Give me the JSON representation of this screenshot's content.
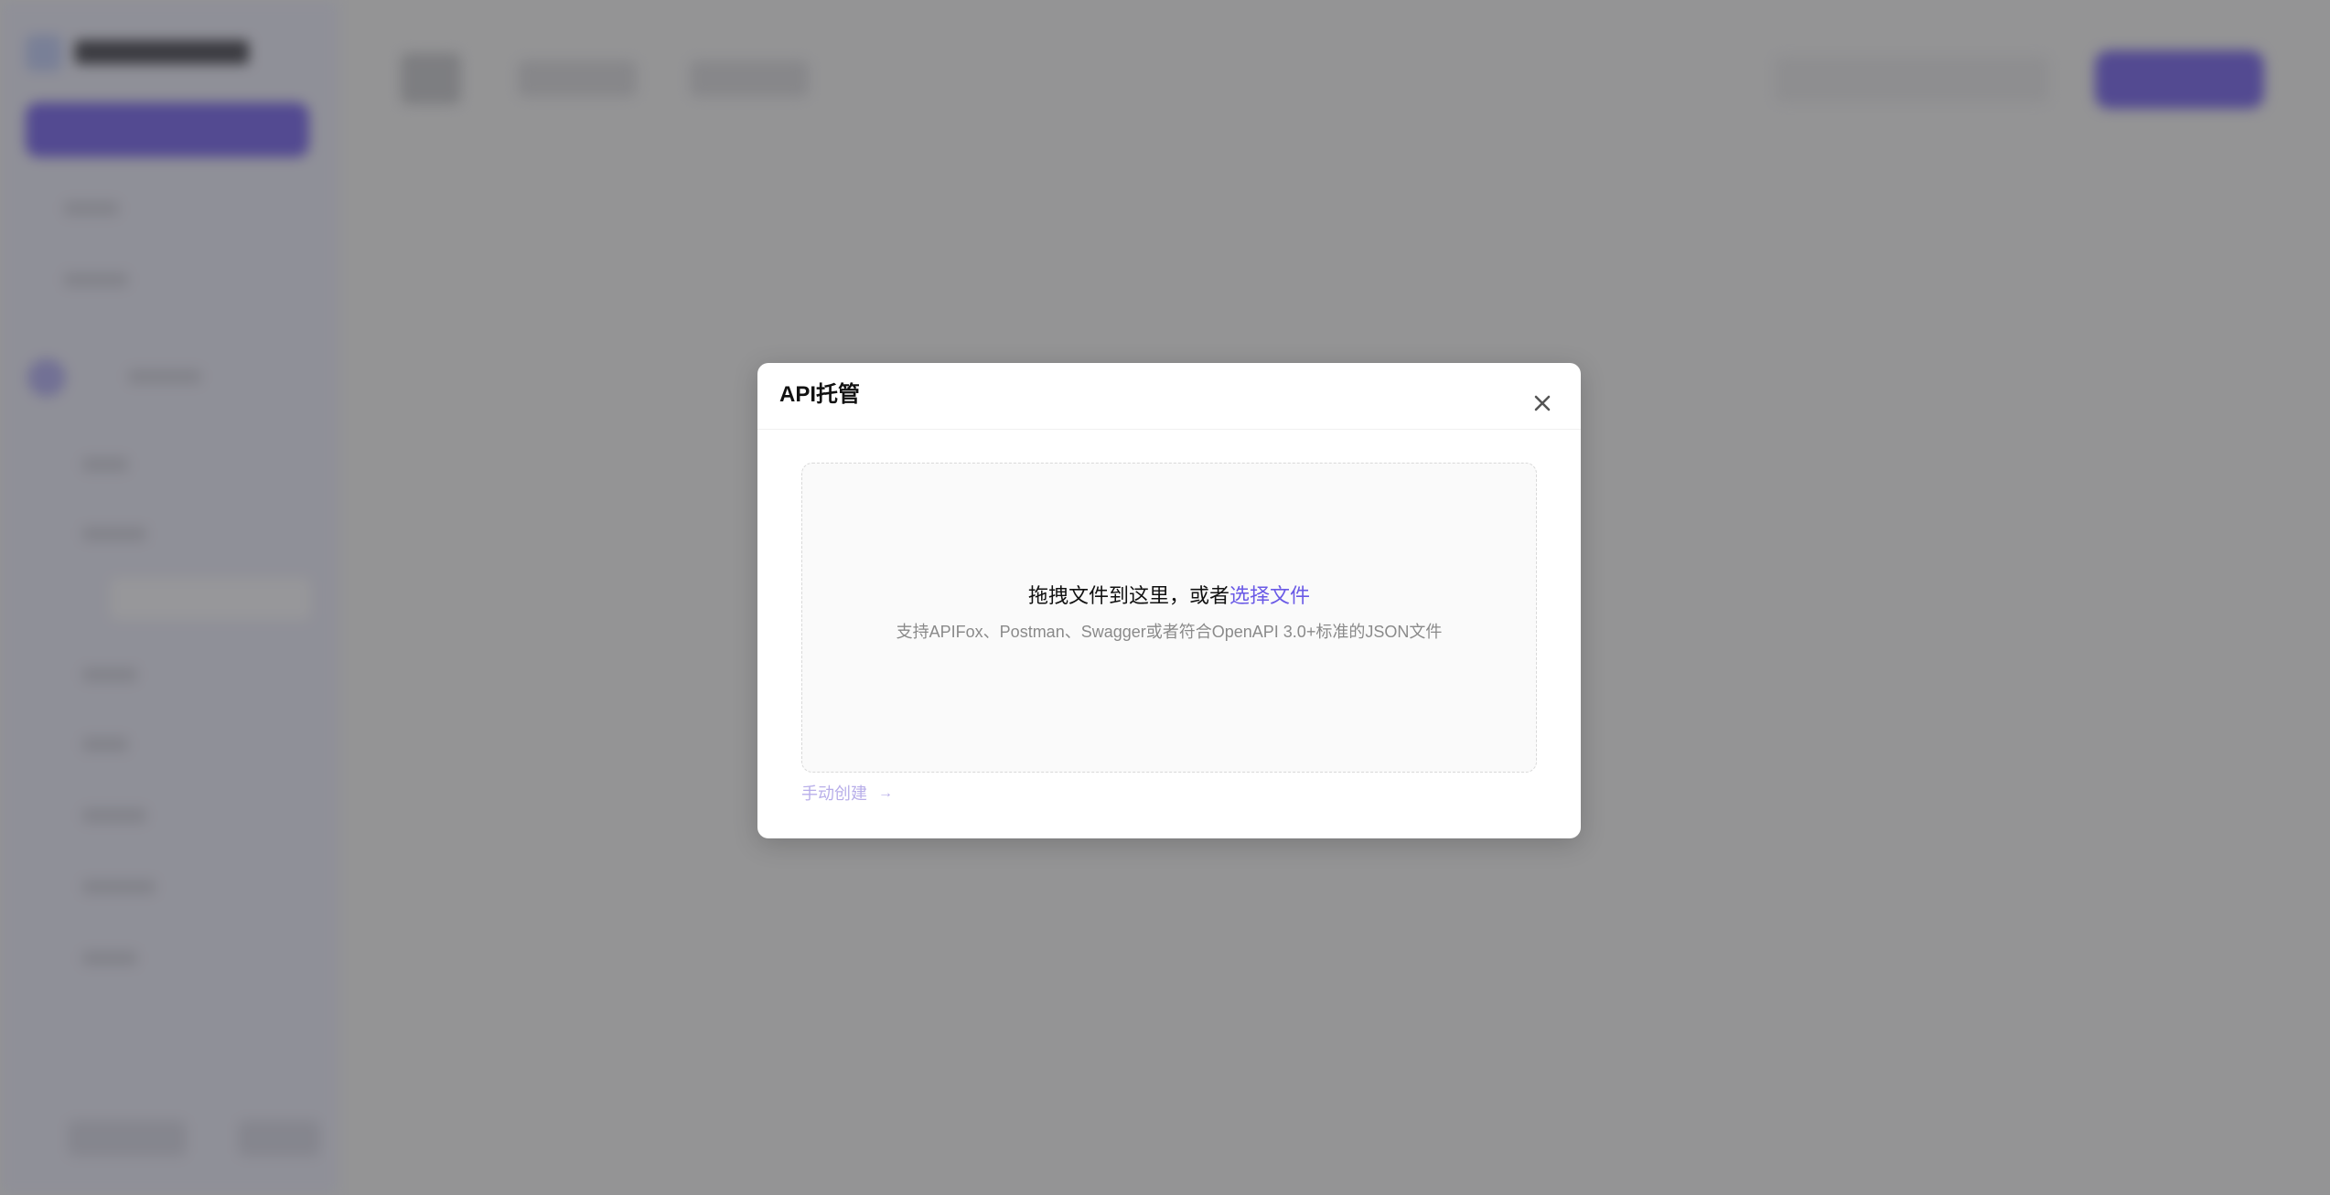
{
  "modal": {
    "title": "API托管",
    "close_icon": "close-icon",
    "dropzone": {
      "prompt": "拖拽文件到这里，或者",
      "select_link": "选择文件",
      "hint": "支持APIFox、Postman、Swagger或者符合OpenAPI 3.0+标准的JSON文件"
    },
    "manual_create": {
      "label": "手动创建",
      "arrow": "→",
      "icon": "arrow-right-icon"
    }
  },
  "colors": {
    "accent": "#6a5ae6",
    "overlay": "#888888",
    "manual_link": "#b8aee9",
    "hint_text": "#8a8a8a"
  }
}
